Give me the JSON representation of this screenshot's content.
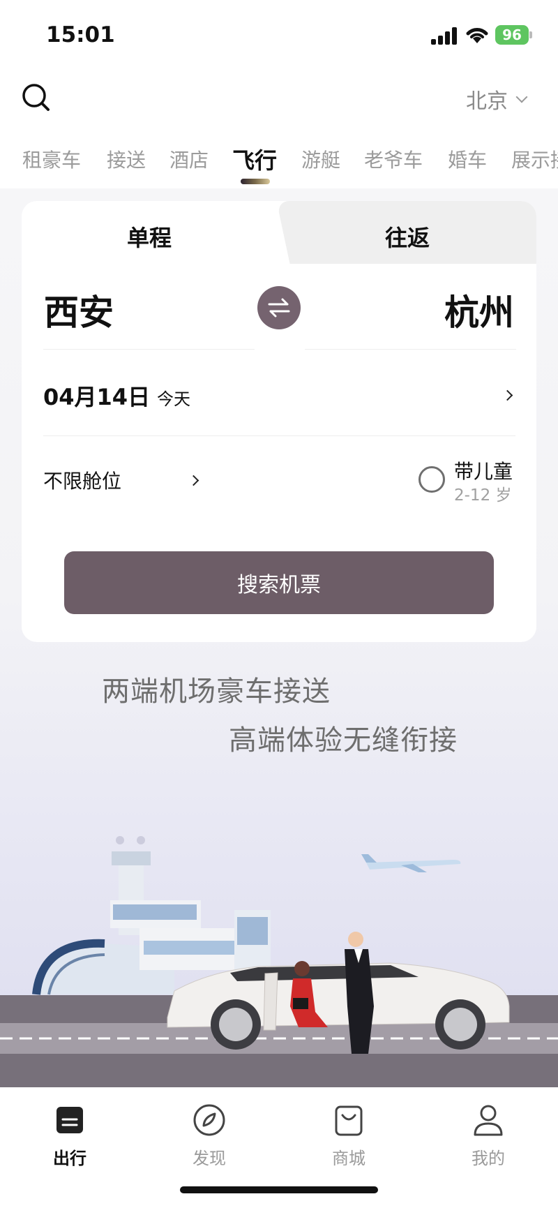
{
  "status_bar": {
    "time": "15:01",
    "battery": "96"
  },
  "header": {
    "city": "北京"
  },
  "categories": [
    "租豪车",
    "接送",
    "酒店",
    "飞行",
    "游艇",
    "老爷车",
    "婚车",
    "展示接"
  ],
  "active_category": "飞行",
  "booking": {
    "trip_types": [
      "单程",
      "往返"
    ],
    "from_city": "西安",
    "to_city": "杭州",
    "date": "04月14日",
    "date_note": "今天",
    "cabin": "不限舱位",
    "child_label": "带儿童",
    "child_age": "2-12 岁",
    "search_button": "搜索机票"
  },
  "promo": {
    "line1": "两端机场豪车接送",
    "line2": "高端体验无缝衔接"
  },
  "bottom_nav": [
    {
      "label": "出行",
      "icon": "trip-icon"
    },
    {
      "label": "发现",
      "icon": "discover-icon"
    },
    {
      "label": "商城",
      "icon": "shop-bag-icon"
    },
    {
      "label": "我的",
      "icon": "profile-icon"
    }
  ],
  "colors": {
    "accent": "#6d5d67",
    "swap": "#75636f",
    "battery": "#5ec560"
  }
}
